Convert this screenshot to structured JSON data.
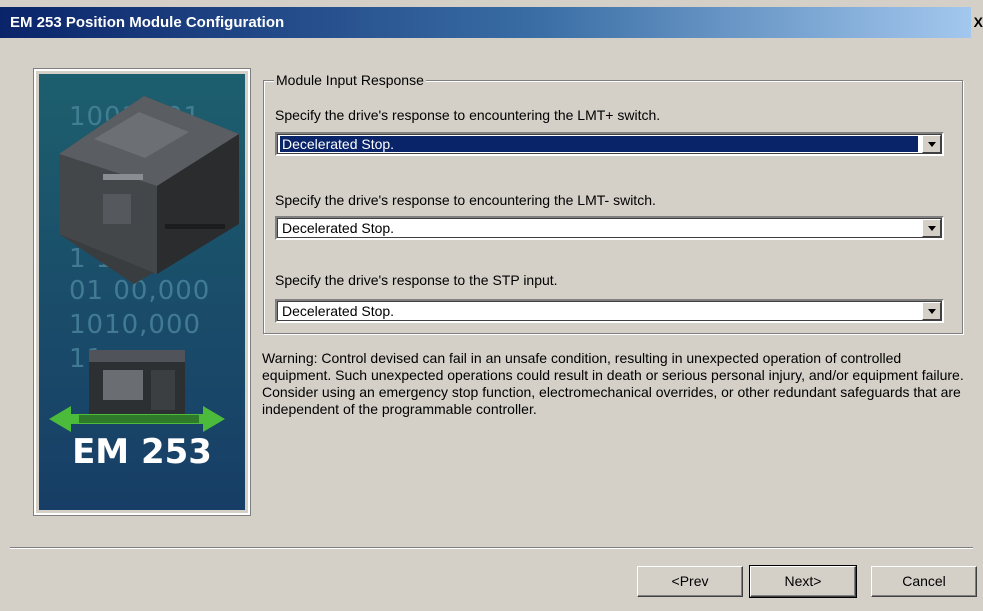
{
  "window": {
    "title": "EM 253 Position Module Configuration",
    "close_glyph": "X"
  },
  "side_image": {
    "binary_rows": [
      "1001 101",
      "1 101",
      "01 00,000",
      "1010,000",
      "11"
    ],
    "product_label": "EM 253"
  },
  "group": {
    "legend": "Module Input Response",
    "lmt_plus": {
      "prompt": "Specify the drive's response to encountering the LMT+ switch.",
      "value": "Decelerated Stop."
    },
    "lmt_minus": {
      "prompt": "Specify the drive's response to encountering the LMT- switch.",
      "value": "Decelerated Stop."
    },
    "stp": {
      "prompt": "Specify the drive's response to the STP input.",
      "value": "Decelerated Stop."
    }
  },
  "warning": "Warning: Control devised can fail in an unsafe condition, resulting in unexpected operation of controlled equipment. Such unexpected operations could result in death or serious personal injury, and/or equipment failure. Consider using an emergency stop function, electromechanical overrides, or other redundant safeguards that are independent of the programmable controller.",
  "buttons": {
    "prev": "<Prev",
    "next": "Next>",
    "cancel": "Cancel"
  },
  "colors": {
    "titlebar_start": "#0a246a",
    "titlebar_end": "#a6caf0",
    "dialog_bg": "#d4d0c8",
    "selection": "#0a246a"
  }
}
